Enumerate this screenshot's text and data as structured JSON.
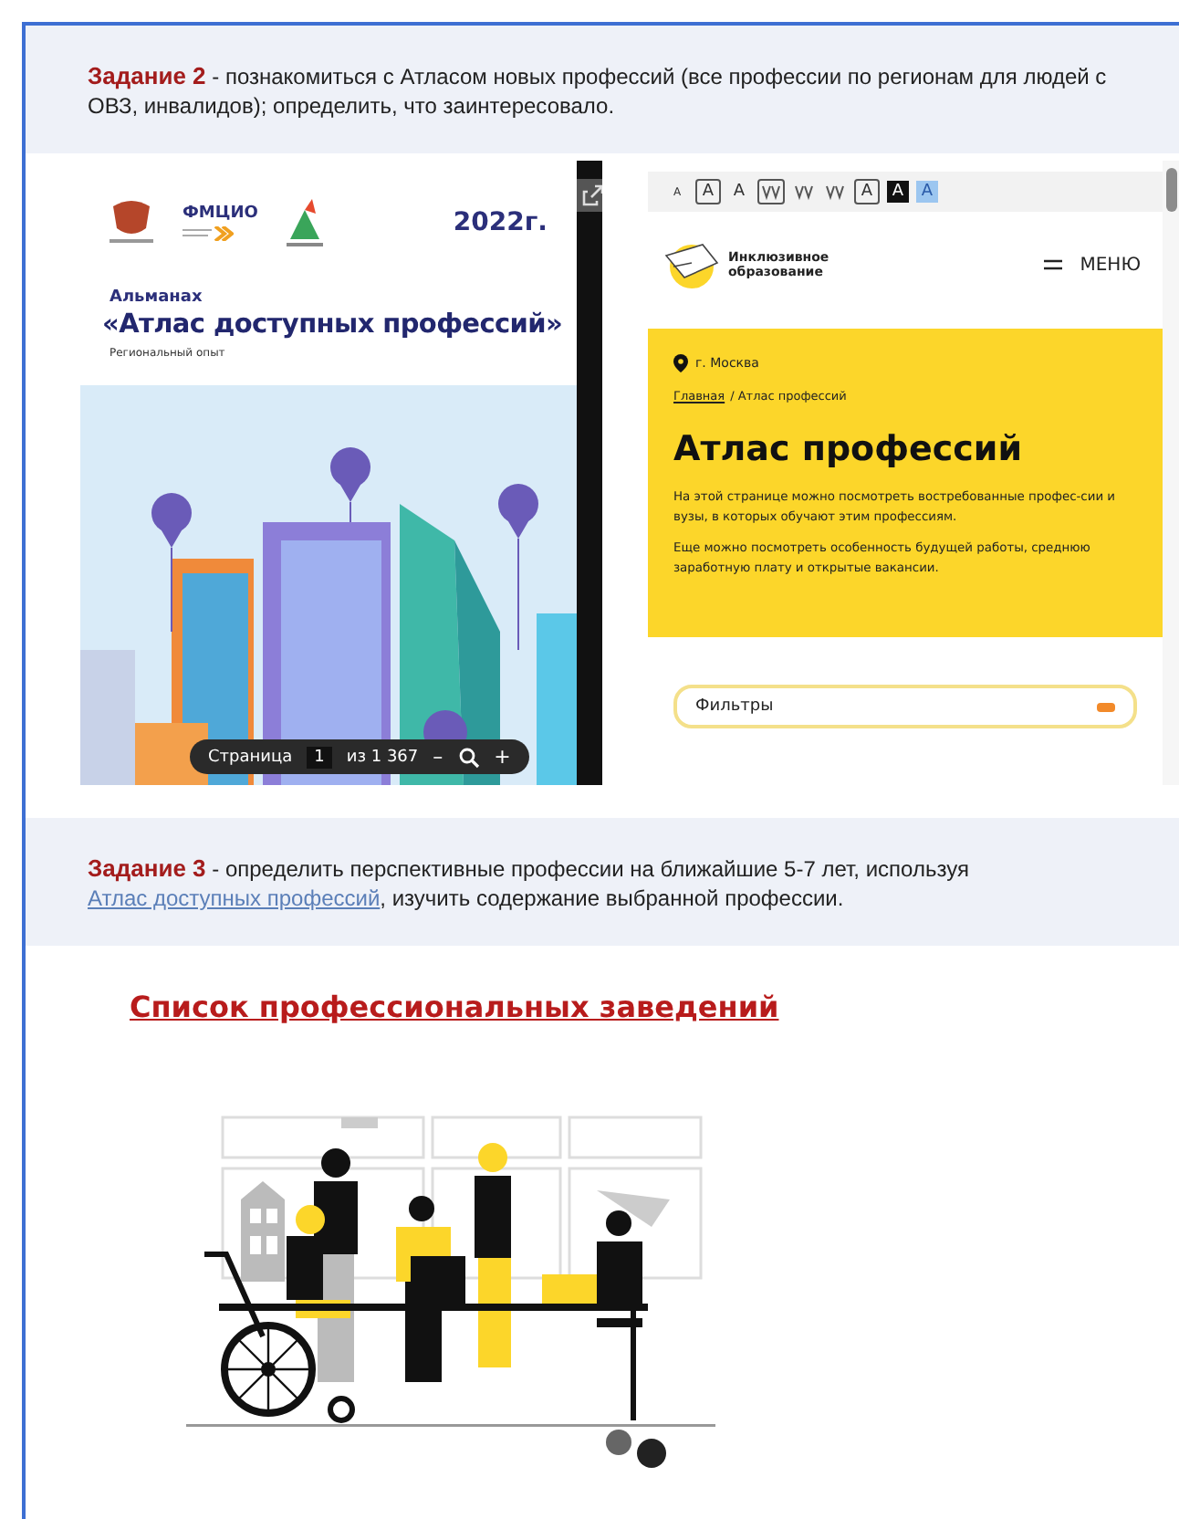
{
  "task_2": {
    "label": "Задание 2",
    "text": "- познакомиться с Атласом новых профессий (все профессии по регионам для людей с ОВЗ, инвалидов); определить, что заинтересовало."
  },
  "pdf_viewer": {
    "logo_text": "ФМЦИО",
    "year": "2022г.",
    "kicker": "Альманах",
    "title": "«Атлас доступных профессий»",
    "subtitle": "Региональный опыт",
    "page_label": "Страница",
    "page_number": "1",
    "page_total": "из 1 367",
    "zoom_out": "–",
    "zoom_in": "+"
  },
  "site_preview": {
    "toolbar": [
      {
        "kind": "small",
        "label": "A"
      },
      {
        "kind": "boxed",
        "label": "A"
      },
      {
        "kind": "plain",
        "label": "A"
      },
      {
        "kind": "spacing-boxed"
      },
      {
        "kind": "spacing"
      },
      {
        "kind": "spacing"
      },
      {
        "kind": "boxed",
        "label": "A"
      },
      {
        "kind": "dark",
        "label": "A"
      },
      {
        "kind": "blue",
        "label": "A"
      }
    ],
    "logo_lines": [
      "Инклюзивное",
      "образование"
    ],
    "menu": "МЕНЮ",
    "city": "г. Москва",
    "breadcrumb_link": "Главная",
    "breadcrumb_current": "/ Атлас профессий",
    "title": "Атлас профессий",
    "paragraphs": [
      "На этой странице можно посмотреть востребованные профес-сии и вузы, в которых обучают этим профессиям.",
      "Еще можно посмотреть особенность будущей работы, среднюю заработную плату и открытые вакансии."
    ],
    "filters": "Фильтры"
  },
  "task_3": {
    "label": "Задание 3",
    "text": "- определить перспективные профессии на ближайшие 5-7 лет, используя",
    "link": "Атлас доступных профессий",
    "after": ", изучить содержание выбранной профессии."
  },
  "heading_link": "Список профессиональных заведений"
}
